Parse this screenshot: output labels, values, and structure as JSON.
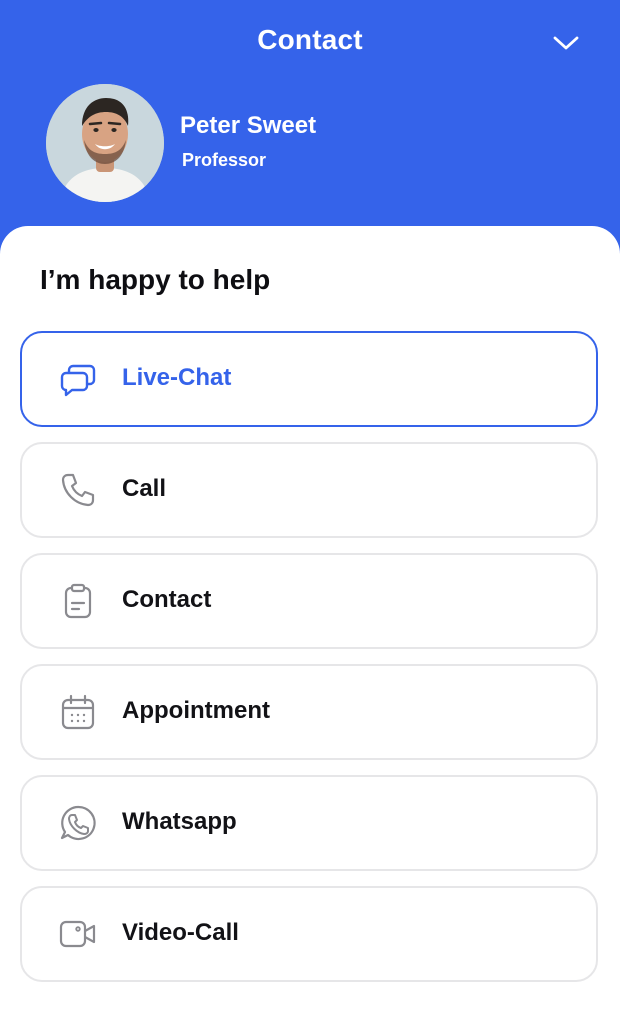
{
  "header": {
    "title": "Contact",
    "collapse_icon": "chevron-down-icon"
  },
  "profile": {
    "name": "Peter Sweet",
    "role": "Professor",
    "avatar": "avatar-photo"
  },
  "sheet": {
    "heading": "I’m happy to help"
  },
  "options": [
    {
      "label": "Live-Chat",
      "icon": "chat-bubbles-icon",
      "active": true
    },
    {
      "label": "Call",
      "icon": "phone-icon",
      "active": false
    },
    {
      "label": "Contact",
      "icon": "clipboard-icon",
      "active": false
    },
    {
      "label": "Appointment",
      "icon": "calendar-icon",
      "active": false
    },
    {
      "label": "Whatsapp",
      "icon": "whatsapp-icon",
      "active": false
    },
    {
      "label": "Video-Call",
      "icon": "video-camera-icon",
      "active": false
    }
  ],
  "colors": {
    "primary": "#3563EA",
    "border": "#e6e6e8",
    "text": "#121216",
    "icon_gray": "#8a8a8f"
  }
}
